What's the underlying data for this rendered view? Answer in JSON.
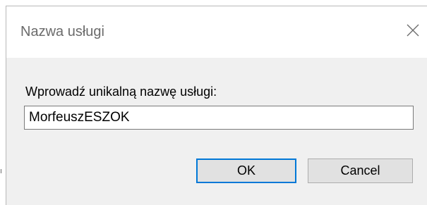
{
  "window": {
    "title": "Nazwa usługi",
    "close_icon": "close-icon"
  },
  "form": {
    "prompt_label": "Wprowadź unikalną nazwę usługi:",
    "service_name_value": "MorfeuszESZOK"
  },
  "buttons": {
    "ok_label": "OK",
    "cancel_label": "Cancel"
  },
  "colors": {
    "dialog_background": "#f0f0f0",
    "titlebar_background": "#ffffff",
    "default_button_border": "#0078d7",
    "button_background": "#e1e1e1"
  }
}
